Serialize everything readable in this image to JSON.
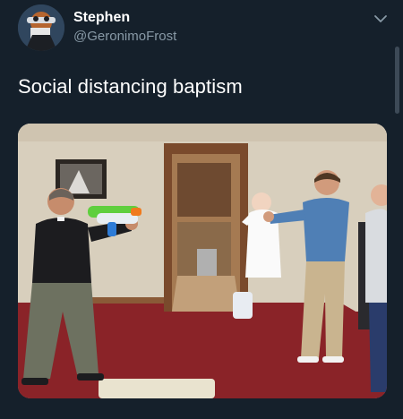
{
  "author": {
    "name": "Stephen",
    "handle": "@GeronimoFrost",
    "avatar_icon": "avatar-image"
  },
  "menu": {
    "icon": "chevron-down-icon"
  },
  "tweet": {
    "text": "Social distancing baptism"
  },
  "media": {
    "kind": "photo"
  },
  "colors": {
    "background": "#15202b",
    "secondary_text": "#8899a6"
  }
}
